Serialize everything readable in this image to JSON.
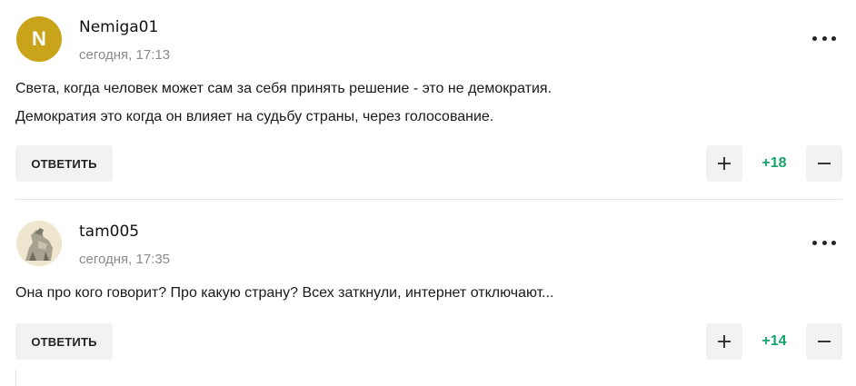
{
  "colors": {
    "score_green": "#14a36b",
    "avatar_n_bg": "#c9a41a",
    "button_bg": "#f2f2f2"
  },
  "comments": [
    {
      "avatar_initial": "N",
      "author": "Nemiga01",
      "date": "сегодня, 17:13",
      "text_lines": [
        "Света, когда человек может сам за себя принять решение - это не демократия.",
        "Демократия это когда он влияет на судьбу страны, через голосование."
      ],
      "reply_label": "ОТВЕТИТЬ",
      "score": "+18",
      "more_icon": "more-dots-icon",
      "plus_icon": "plus-icon",
      "minus_icon": "minus-icon"
    },
    {
      "avatar_image": "horse-statue-avatar",
      "author": "tam005",
      "date": "сегодня, 17:35",
      "text_lines": [
        "Она про кого говорит? Про какую страну? Всех заткнули, интернет отключают..."
      ],
      "reply_label": "ОТВЕТИТЬ",
      "score": "+14",
      "more_icon": "more-dots-icon",
      "plus_icon": "plus-icon",
      "minus_icon": "minus-icon"
    }
  ]
}
